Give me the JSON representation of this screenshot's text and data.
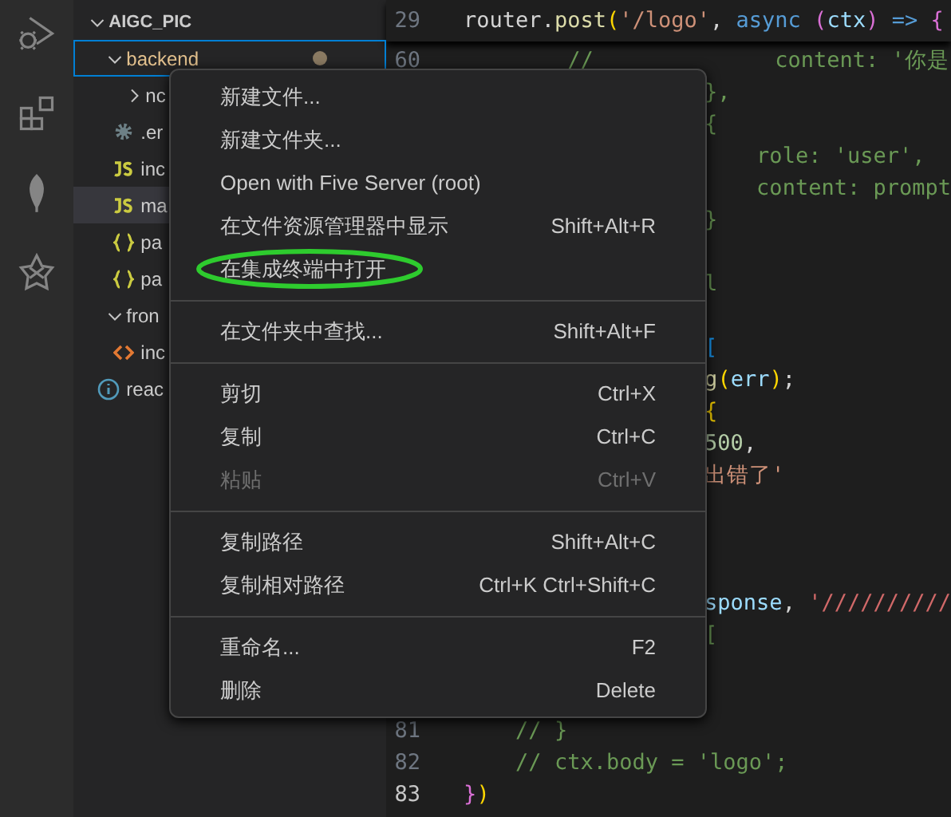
{
  "activity_bar": {
    "items": [
      {
        "kind": "debug",
        "selected": false
      },
      {
        "kind": "extensions",
        "selected": false
      },
      {
        "kind": "leaf",
        "selected": false
      },
      {
        "kind": "star",
        "selected": false
      }
    ]
  },
  "explorer": {
    "root": {
      "label": "AIGC_PIC",
      "expanded": true,
      "children": [
        {
          "label": "backend",
          "kind": "folder",
          "expanded": true,
          "selected": false,
          "focused": true,
          "modified": true,
          "children": [
            {
              "label": "nc",
              "kind": "folder",
              "expanded": false,
              "selected": false,
              "focused": false,
              "modified": false
            },
            {
              "label": ".er",
              "kind": "gear",
              "selected": false,
              "focused": false,
              "modified": false
            },
            {
              "label": "inc",
              "kind": "js",
              "selected": false,
              "focused": false,
              "modified": false
            },
            {
              "label": "ma",
              "kind": "js",
              "selected": true,
              "focused": false,
              "modified": false
            },
            {
              "label": "pa",
              "kind": "json",
              "selected": false,
              "focused": false,
              "modified": false
            },
            {
              "label": "pa",
              "kind": "json",
              "selected": false,
              "focused": false,
              "modified": false
            }
          ]
        },
        {
          "label": "fron",
          "kind": "folder",
          "expanded": true,
          "selected": false,
          "focused": false,
          "modified": false,
          "children": [
            {
              "label": "inc",
              "kind": "html",
              "selected": false,
              "focused": false,
              "modified": false
            }
          ]
        },
        {
          "label": "reac",
          "kind": "info",
          "selected": false,
          "focused": false,
          "modified": false
        }
      ]
    }
  },
  "editor": {
    "sticky": {
      "number": "29",
      "tokens": [
        {
          "text": "router.",
          "kind": "plain"
        },
        {
          "text": "post",
          "kind": "func"
        },
        {
          "text": "(",
          "kind": "bracket1"
        },
        {
          "text": "'/logo'",
          "kind": "string"
        },
        {
          "text": ", ",
          "kind": "plain"
        },
        {
          "text": "async",
          "kind": "keyword"
        },
        {
          "text": " (",
          "kind": "bracket2"
        },
        {
          "text": "ctx",
          "kind": "var"
        },
        {
          "text": ")",
          "kind": "bracket2"
        },
        {
          "text": " => ",
          "kind": "keyword"
        },
        {
          "text": "{",
          "kind": "bracket2"
        }
      ]
    },
    "lines": [
      {
        "kind": "full",
        "number": "60",
        "current": false,
        "tokens": [
          {
            "text": "        //              content: '你是",
            "kind": "comment"
          }
        ]
      },
      {
        "kind": "partial",
        "tokens": [
          {
            "text": "},",
            "kind": "comment"
          }
        ]
      },
      {
        "kind": "partial",
        "tokens": [
          {
            "text": "{",
            "kind": "comment"
          }
        ]
      },
      {
        "kind": "partial",
        "tokens": [
          {
            "text": "    role: 'user',",
            "kind": "comment"
          }
        ]
      },
      {
        "kind": "partial",
        "tokens": [
          {
            "text": "    content: prompt",
            "kind": "comment"
          }
        ]
      },
      {
        "kind": "partial",
        "tokens": [
          {
            "text": "}",
            "kind": "comment"
          }
        ]
      },
      {
        "kind": "hidden"
      },
      {
        "kind": "partial",
        "tokens": [
          {
            "text": "l",
            "kind": "comment"
          }
        ]
      },
      {
        "kind": "hidden"
      },
      {
        "kind": "partial",
        "tokens": [
          {
            "text": "[",
            "kind": "bracket3"
          }
        ]
      },
      {
        "kind": "partial",
        "tokens": [
          {
            "text": "g",
            "kind": "func"
          },
          {
            "text": "(",
            "kind": "bracket1"
          },
          {
            "text": "err",
            "kind": "var"
          },
          {
            "text": ")",
            "kind": "bracket1"
          },
          {
            "text": ";",
            "kind": "plain"
          }
        ]
      },
      {
        "kind": "partial",
        "tokens": [
          {
            "text": "{",
            "kind": "bracket1"
          }
        ]
      },
      {
        "kind": "partial",
        "tokens": [
          {
            "text": "500",
            "kind": "number"
          },
          {
            "text": ",",
            "kind": "plain"
          }
        ]
      },
      {
        "kind": "partial",
        "tokens": [
          {
            "text": "出错了'",
            "kind": "string"
          }
        ]
      },
      {
        "kind": "hidden"
      },
      {
        "kind": "hidden"
      },
      {
        "kind": "hidden"
      },
      {
        "kind": "partial",
        "tokens": [
          {
            "text": "sponse",
            "kind": "var"
          },
          {
            "text": ", ",
            "kind": "plain"
          },
          {
            "text": "'//////////",
            "kind": "regex"
          }
        ]
      },
      {
        "kind": "partial",
        "tokens": [
          {
            "text": "[",
            "kind": "comment"
          }
        ]
      },
      {
        "kind": "hidden"
      },
      {
        "kind": "hidden"
      },
      {
        "kind": "full",
        "number": "81",
        "current": false,
        "tokens": [
          {
            "text": "    // }",
            "kind": "comment"
          }
        ]
      },
      {
        "kind": "full",
        "number": "82",
        "current": false,
        "tokens": [
          {
            "text": "    // ctx.body = 'logo';",
            "kind": "comment"
          }
        ]
      },
      {
        "kind": "full",
        "number": "83",
        "current": true,
        "tokens": [
          {
            "text": "}",
            "kind": "bracket2"
          },
          {
            "text": ")",
            "kind": "bracket1"
          }
        ]
      }
    ]
  },
  "context_menu": {
    "items": [
      {
        "kind": "item",
        "label": "新建文件...",
        "disabled": false,
        "highlighted": false
      },
      {
        "kind": "item",
        "label": "新建文件夹...",
        "disabled": false,
        "highlighted": false
      },
      {
        "kind": "item",
        "label": "Open with Five Server (root)",
        "disabled": false,
        "highlighted": false
      },
      {
        "kind": "item",
        "label": "在文件资源管理器中显示",
        "shortcut": "Shift+Alt+R",
        "disabled": false,
        "highlighted": false
      },
      {
        "kind": "item",
        "label": "在集成终端中打开",
        "disabled": false,
        "highlighted": true
      },
      {
        "kind": "separator"
      },
      {
        "kind": "item",
        "label": "在文件夹中查找...",
        "shortcut": "Shift+Alt+F",
        "disabled": false,
        "highlighted": false
      },
      {
        "kind": "separator"
      },
      {
        "kind": "item",
        "label": "剪切",
        "shortcut": "Ctrl+X",
        "disabled": false,
        "highlighted": false
      },
      {
        "kind": "item",
        "label": "复制",
        "shortcut": "Ctrl+C",
        "disabled": false,
        "highlighted": false
      },
      {
        "kind": "item",
        "label": "粘贴",
        "shortcut": "Ctrl+V",
        "disabled": true,
        "highlighted": false
      },
      {
        "kind": "separator"
      },
      {
        "kind": "item",
        "label": "复制路径",
        "shortcut": "Shift+Alt+C",
        "disabled": false,
        "highlighted": false
      },
      {
        "kind": "item",
        "label": "复制相对路径",
        "shortcut": "Ctrl+K Ctrl+Shift+C",
        "disabled": false,
        "highlighted": false
      },
      {
        "kind": "separator"
      },
      {
        "kind": "item",
        "label": "重命名...",
        "shortcut": "F2",
        "disabled": false,
        "highlighted": false
      },
      {
        "kind": "item",
        "label": "删除",
        "shortcut": "Delete",
        "disabled": false,
        "highlighted": false
      }
    ]
  }
}
